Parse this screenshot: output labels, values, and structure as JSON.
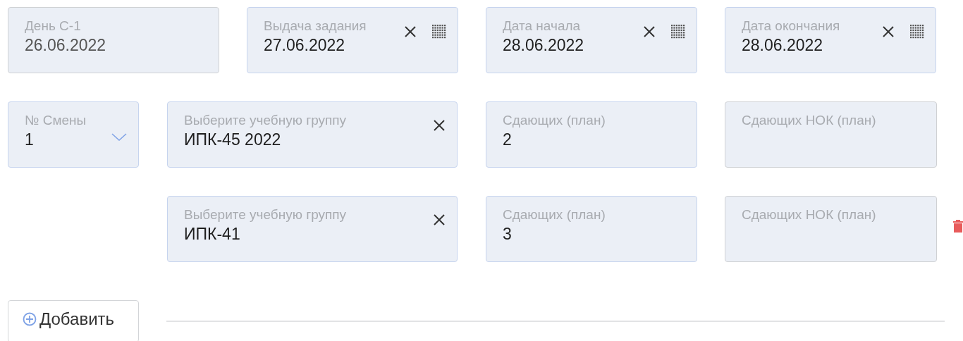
{
  "top_row": [
    {
      "kind": "text",
      "label": "День С-1",
      "value": "26.06.2022",
      "disabled": true
    },
    {
      "kind": "date",
      "label": "Выдача задания",
      "value": "27.06.2022",
      "disabled": false
    },
    {
      "kind": "date",
      "label": "Дата начала",
      "value": "28.06.2022",
      "disabled": false
    },
    {
      "kind": "date",
      "label": "Дата окончания",
      "value": "28.06.2022",
      "disabled": false
    }
  ],
  "shift": {
    "label": "№ Смены",
    "value": "1"
  },
  "groups": [
    {
      "group": {
        "label": "Выберите учебную группу",
        "value": "ИПК-45 2022"
      },
      "passing": {
        "label": "Сдающих (план)",
        "value": "2"
      },
      "passing_nok": {
        "label": "Сдающих НОК (план)"
      },
      "removable": false
    },
    {
      "group": {
        "label": "Выберите учебную группу",
        "value": "ИПК-41"
      },
      "passing": {
        "label": "Сдающих (план)",
        "value": "3"
      },
      "passing_nok": {
        "label": "Сдающих НОК (план)"
      },
      "removable": true
    }
  ],
  "add_button": {
    "label": "Добавить"
  }
}
